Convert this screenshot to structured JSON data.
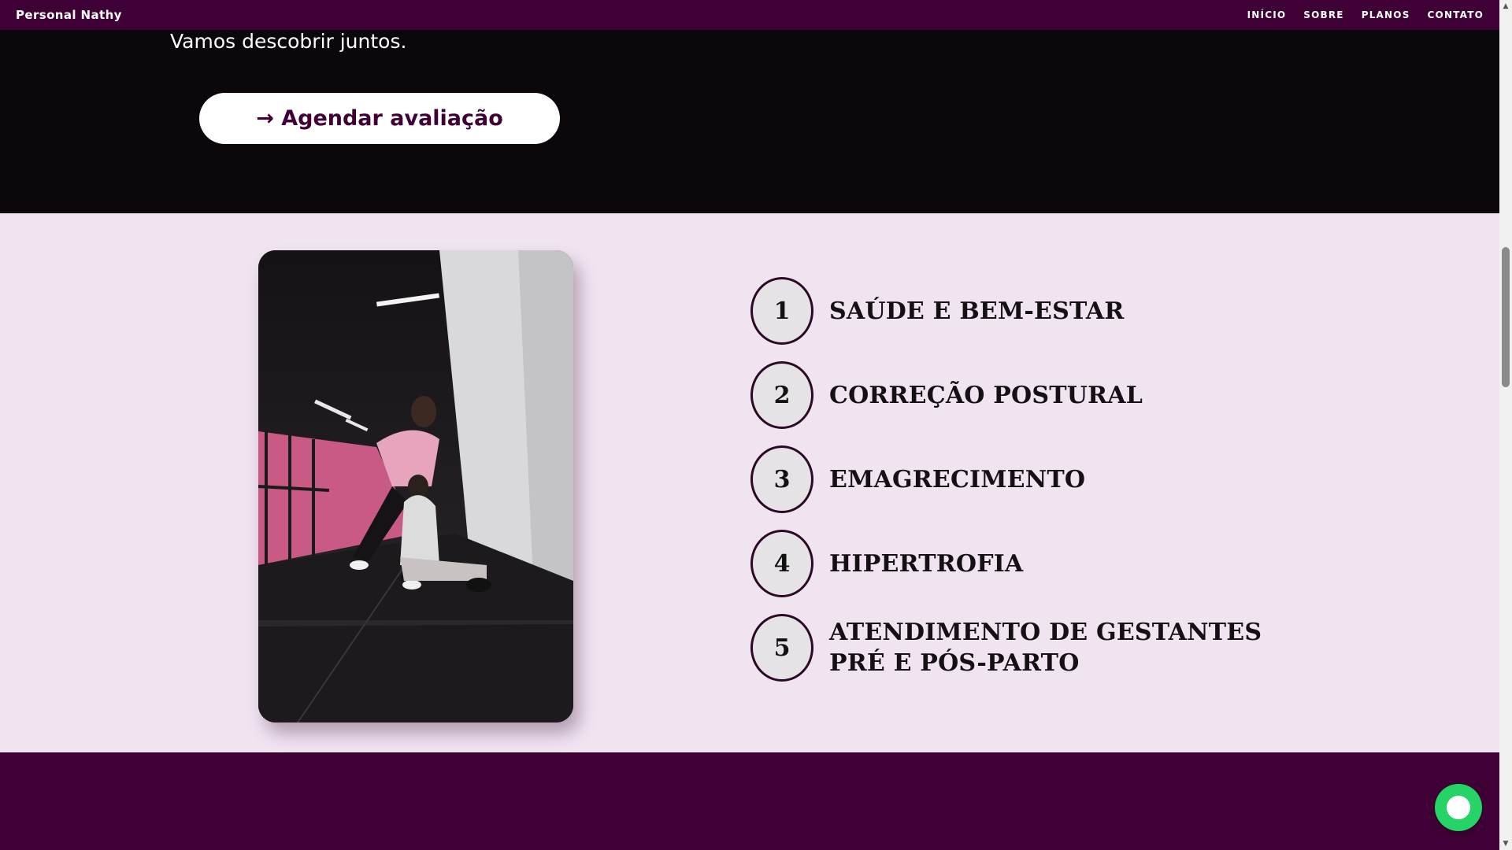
{
  "header": {
    "brand": "Personal Nathy",
    "nav": [
      "INÍCIO",
      "SOBRE",
      "PLANOS",
      "CONTATO"
    ]
  },
  "hero": {
    "text": "Vamos descobrir juntos.",
    "cta_label": "→ Agendar avaliação"
  },
  "services": {
    "items": [
      {
        "number": "1",
        "line1": "SAÚDE E BEM-ESTAR",
        "line2": ""
      },
      {
        "number": "2",
        "line1": "CORREÇÃO POSTURAL",
        "line2": ""
      },
      {
        "number": "3",
        "line1": "EMAGRECIMENTO",
        "line2": ""
      },
      {
        "number": "4",
        "line1": "HIPERTROFIA",
        "line2": ""
      },
      {
        "number": "5",
        "line1": "ATENDIMENTO DE GESTANTES",
        "line2": "PRÉ E PÓS-PARTO"
      }
    ]
  },
  "colors": {
    "nav_bg": "#3f0035",
    "hero_bg": "#0b070b",
    "section_bg": "#f1e4f1",
    "whatsapp": "#25d366"
  },
  "icons": {
    "whatsapp": "whatsapp-icon"
  }
}
